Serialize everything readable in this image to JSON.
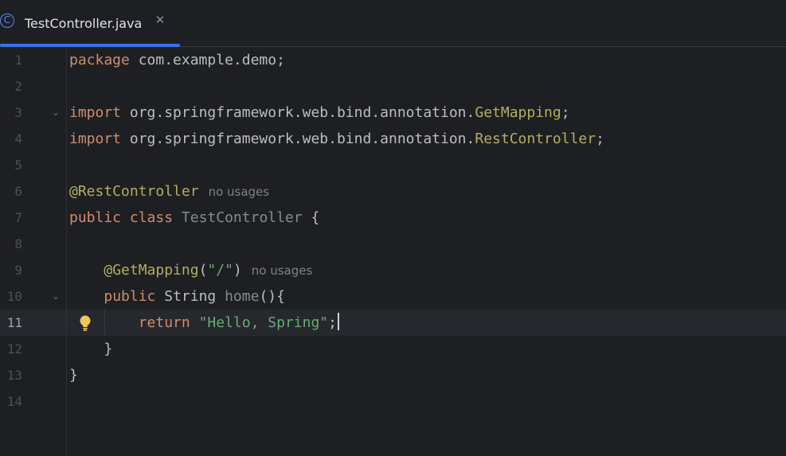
{
  "tab": {
    "title": "TestController.java",
    "icon": "java-class-icon",
    "icon_glyph": "C",
    "close_glyph": "✕"
  },
  "editor": {
    "current_line": 11,
    "lines": [
      {
        "num": "1",
        "tokens": [
          {
            "t": "package",
            "c": "kw"
          },
          {
            "t": " com.example.demo;",
            "c": "pkg"
          }
        ]
      },
      {
        "num": "2",
        "tokens": []
      },
      {
        "num": "3",
        "fold": "⌄",
        "tokens": [
          {
            "t": "import",
            "c": "kw"
          },
          {
            "t": " org.springframework.web.bind.annotation.",
            "c": "pkg"
          },
          {
            "t": "GetMapping",
            "c": "ann"
          },
          {
            "t": ";",
            "c": "punct"
          }
        ]
      },
      {
        "num": "4",
        "tokens": [
          {
            "t": "import",
            "c": "kw"
          },
          {
            "t": " org.springframework.web.bind.annotation.",
            "c": "pkg"
          },
          {
            "t": "RestController",
            "c": "ann"
          },
          {
            "t": ";",
            "c": "punct"
          }
        ]
      },
      {
        "num": "5",
        "tokens": []
      },
      {
        "num": "6",
        "tokens": [
          {
            "t": "@RestController",
            "c": "ann"
          }
        ],
        "hint": "no usages"
      },
      {
        "num": "7",
        "tokens": [
          {
            "t": "public",
            "c": "kw"
          },
          {
            "t": " ",
            "c": "punct"
          },
          {
            "t": "class",
            "c": "kw"
          },
          {
            "t": " ",
            "c": "punct"
          },
          {
            "t": "TestController",
            "c": "unused"
          },
          {
            "t": " {",
            "c": "punct"
          }
        ]
      },
      {
        "num": "8",
        "tokens": []
      },
      {
        "num": "9",
        "tokens": [
          {
            "t": "    ",
            "c": "punct"
          },
          {
            "t": "@GetMapping",
            "c": "ann"
          },
          {
            "t": "(",
            "c": "punct"
          },
          {
            "t": "\"/\"",
            "c": "str"
          },
          {
            "t": ")",
            "c": "punct"
          }
        ],
        "hint": "no usages"
      },
      {
        "num": "10",
        "fold": "⌄",
        "tokens": [
          {
            "t": "    ",
            "c": "punct"
          },
          {
            "t": "public",
            "c": "kw"
          },
          {
            "t": " String ",
            "c": "punct"
          },
          {
            "t": "home",
            "c": "unused"
          },
          {
            "t": "(){",
            "c": "punct"
          }
        ]
      },
      {
        "num": "11",
        "bulb": true,
        "caret": true,
        "tokens": [
          {
            "t": "        ",
            "c": "punct"
          },
          {
            "t": "return",
            "c": "kw"
          },
          {
            "t": " ",
            "c": "punct"
          },
          {
            "t": "\"Hello, Spring\"",
            "c": "str"
          },
          {
            "t": ";",
            "c": "punct"
          }
        ]
      },
      {
        "num": "12",
        "tokens": [
          {
            "t": "    }",
            "c": "punct"
          }
        ]
      },
      {
        "num": "13",
        "tokens": [
          {
            "t": "}",
            "c": "punct"
          }
        ]
      },
      {
        "num": "14",
        "tokens": []
      }
    ]
  },
  "colors": {
    "background": "#1e1f22",
    "keyword": "#cf8e6d",
    "annotation": "#b3ae60",
    "string": "#6aab73",
    "accent": "#3574f0"
  }
}
